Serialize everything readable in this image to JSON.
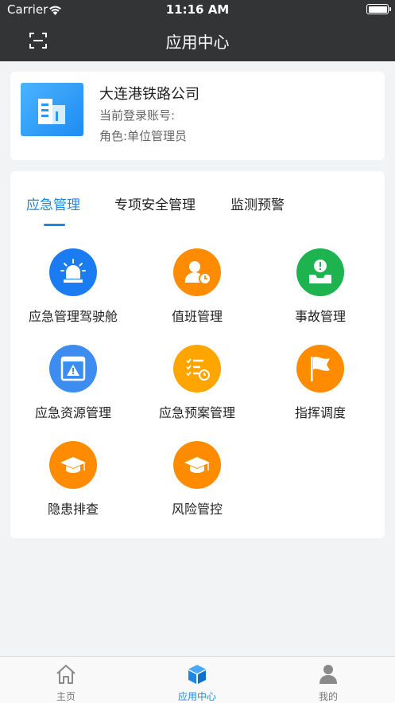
{
  "status_bar": {
    "carrier": "Carrier",
    "time": "11:16 AM"
  },
  "nav": {
    "title": "应用中心",
    "left_icon": "scan-icon"
  },
  "company": {
    "name": "大连港铁路公司",
    "account_label": "当前登录账号:",
    "role_label": "角色:单位管理员"
  },
  "tabs": [
    {
      "label": "应急管理",
      "active": true
    },
    {
      "label": "专项安全管理",
      "active": false
    },
    {
      "label": "监测预警",
      "active": false
    }
  ],
  "modules": [
    {
      "label": "应急管理驾驶舱",
      "icon": "siren-icon",
      "color": "#1a7cf0"
    },
    {
      "label": "值班管理",
      "icon": "duty-person-icon",
      "color": "#ff8c00"
    },
    {
      "label": "事故管理",
      "icon": "accident-tray-icon",
      "color": "#1db34f"
    },
    {
      "label": "应急资源管理",
      "icon": "warning-window-icon",
      "color": "#3d8cf0"
    },
    {
      "label": "应急预案管理",
      "icon": "checklist-icon",
      "color": "#ffa500"
    },
    {
      "label": "指挥调度",
      "icon": "flag-icon",
      "color": "#ff8c00"
    },
    {
      "label": "隐患排查",
      "icon": "graduation-cap-icon",
      "color": "#ff8c00"
    },
    {
      "label": "风险管控",
      "icon": "graduation-cap-icon",
      "color": "#ff8c00"
    }
  ],
  "tab_bar": [
    {
      "label": "主页",
      "icon": "home-icon",
      "active": false
    },
    {
      "label": "应用中心",
      "icon": "cube-icon",
      "active": true
    },
    {
      "label": "我的",
      "icon": "person-icon",
      "active": false
    }
  ],
  "colors": {
    "accent": "#1a88e6",
    "header": "#333436"
  }
}
